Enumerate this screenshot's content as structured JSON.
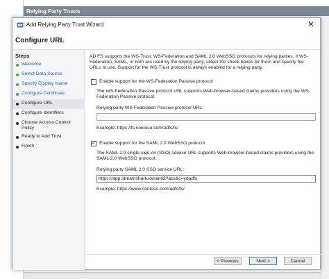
{
  "mmc": {
    "pane_title": "Relying Party Trusts"
  },
  "wizard": {
    "title": "Add Relying Party Trust Wizard",
    "close_glyph": "✕",
    "page_title": "Configure URL",
    "steps_heading": "Steps",
    "steps": [
      {
        "label": "Welcome",
        "state": "done"
      },
      {
        "label": "Select Data Source",
        "state": "done"
      },
      {
        "label": "Specify Display Name",
        "state": "done"
      },
      {
        "label": "Configure Certificate",
        "state": "done"
      },
      {
        "label": "Configure URL",
        "state": "current"
      },
      {
        "label": "Configure Identifiers",
        "state": "todo"
      },
      {
        "label": "Choose Access Control Policy",
        "state": "todo"
      },
      {
        "label": "Ready to Add Trust",
        "state": "todo"
      },
      {
        "label": "Finish",
        "state": "todo"
      }
    ],
    "intro": "AD FS supports the WS-Trust, WS-Federation and SAML 2.0 WebSSO protocols for relying parties.  If WS-Federation, SAML, or both are used by the relying party, select the check boxes for them and specify the URLs to use.  Support for the WS-Trust protocol is always enabled for a relying party.",
    "ws_fed": {
      "checkbox_label": "Enable support for the WS-Federation Passive protocol",
      "checked": false,
      "description": "The WS-Federation Passive protocol URL supports Web-browser-based claims providers using the WS-Federation Passive protocol.",
      "field_label": "Relying party WS-Federation Passive protocol URL:",
      "value": "",
      "example": "Example: https://fs.contoso.com/adfs/ls/"
    },
    "saml": {
      "checkbox_label": "Enable support for the SAML 2.0 WebSSO protocol",
      "checked": true,
      "check_glyph": "✓",
      "description": "The SAML 2.0 single-sign-on (SSO) service URL supports Web-browser-based claims providers using the SAML 2.0 WebSSO protocol.",
      "field_label": "Relying party SAML 2.0 SSO service URL:",
      "value": "https://app.streamshark.io/saml2?acs&c=ydadfs",
      "example": "Example: https://www.contoso.com/adfs/ls/"
    },
    "buttons": {
      "previous": "< Previous",
      "next": "Next >",
      "cancel": "Cancel"
    }
  },
  "colors": {
    "done_dot": "#3bb33b",
    "link": "#1a5fb4",
    "header_bg": "#7d8794"
  }
}
